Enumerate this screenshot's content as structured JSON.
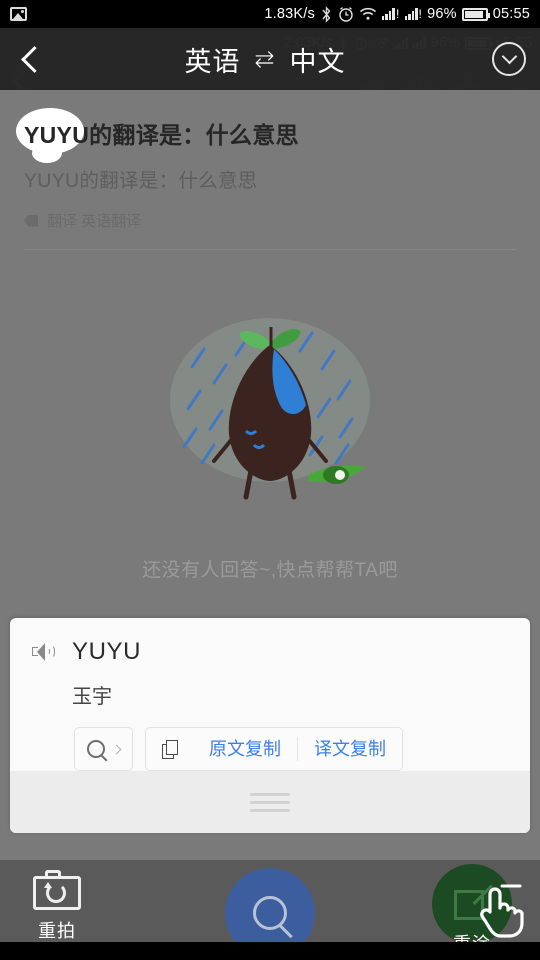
{
  "statusbar": {
    "left_icon": "image-icon",
    "network_speed": "1.83K/s",
    "bluetooth_icon": "bluetooth-icon",
    "alarm_icon": "alarm-icon",
    "wifi_icon": "wifi-icon",
    "signal1_icon": "signal-bars-icon",
    "signal1_badge": "!",
    "signal2_icon": "signal-bars-icon",
    "signal2_badge": "!",
    "battery_percent": "96%",
    "battery_icon": "battery-icon",
    "clock": "05:55"
  },
  "ghost_layer": {
    "network_speed": "2.03K/s",
    "battery_percent": "96%",
    "clock": "05:55",
    "back_icon": "chevron-left-icon",
    "icons": [
      "comment-icon",
      "camera-icon",
      "star-icon",
      "more-icon"
    ]
  },
  "header": {
    "back_icon": "chevron-left-icon",
    "source_language": "英语",
    "swap_symbol": "⇆",
    "target_language": "中文",
    "collapse_icon": "chevron-down-circle-icon"
  },
  "question": {
    "title": "YUYU的翻译是：什么意思",
    "subtitle": "YUYU的翻译是：什么意思",
    "tag_icon": "tag-icon",
    "tags": "翻译 英语翻译"
  },
  "empty_state": {
    "illustration": "sad-seed-in-rain-illustration",
    "message": "还没有人回答~,快点帮帮TA吧"
  },
  "result_card": {
    "speaker_icon": "speaker-icon",
    "word": "YUYU",
    "translation": "玉宇",
    "search_icon": "search-icon",
    "search_chevron_icon": "chevron-right-icon",
    "copy_icon": "copy-icon",
    "copy_source_label": "原文复制",
    "copy_translation_label": "译文复制",
    "drag_handle_icon": "drag-handle-icon"
  },
  "toolbar": {
    "retake_icon": "camera-retake-icon",
    "retake_label": "重拍",
    "search_icon": "search-icon",
    "repaint_icon": "edit-square-icon",
    "repaint_label": "重涂"
  },
  "colors": {
    "accent_blue": "#3d7fe8",
    "search_button": "#3d5e9e",
    "repaint_button": "#1c4a22",
    "header_bg": "#2a2a2a",
    "content_bg": "#7a7a7a",
    "toolbar_bg": "#5a5a5a"
  },
  "cursor": {
    "icon": "pointer-hand-cursor"
  }
}
